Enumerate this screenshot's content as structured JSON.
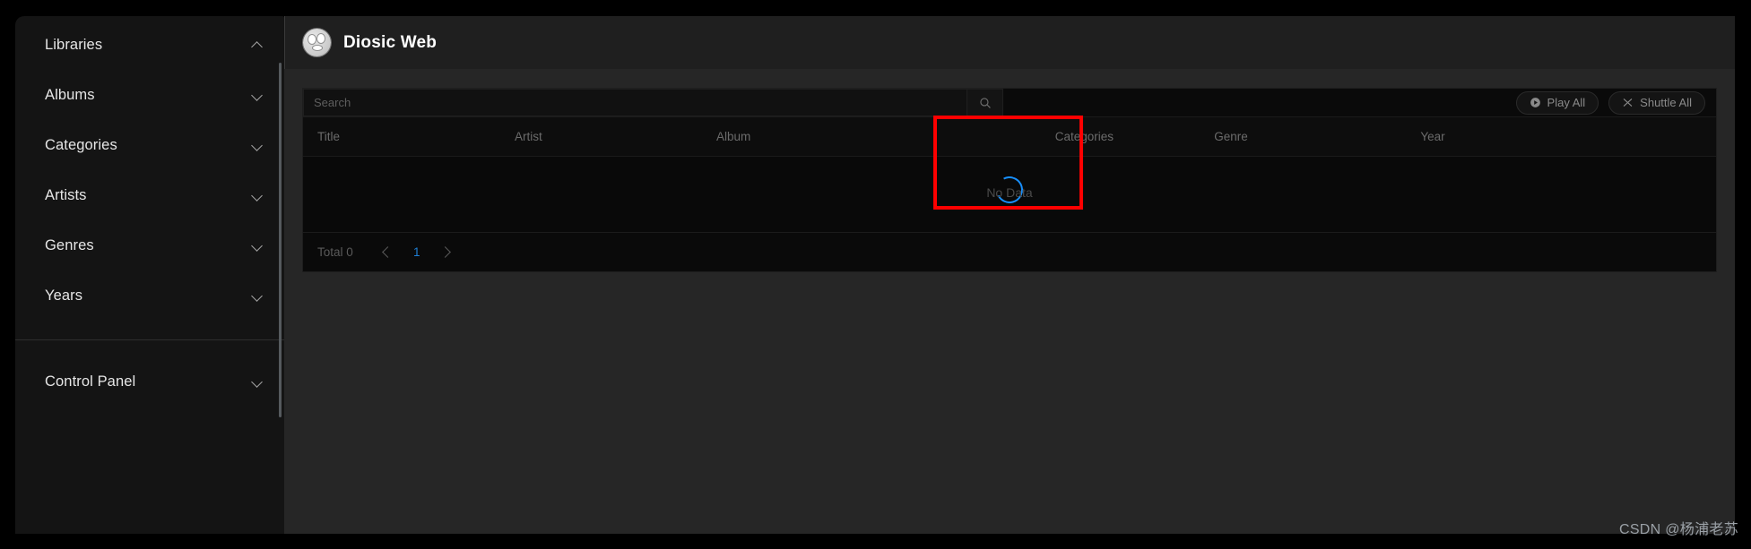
{
  "app": {
    "title": "Diosic Web",
    "logo_icon": "face-logo-icon"
  },
  "sidebar": {
    "items": [
      {
        "label": "Libraries",
        "icon": "chevron-up-icon",
        "expanded": true
      },
      {
        "label": "Albums",
        "icon": "chevron-down-icon",
        "expanded": false
      },
      {
        "label": "Categories",
        "icon": "chevron-down-icon",
        "expanded": false
      },
      {
        "label": "Artists",
        "icon": "chevron-down-icon",
        "expanded": false
      },
      {
        "label": "Genres",
        "icon": "chevron-down-icon",
        "expanded": false
      },
      {
        "label": "Years",
        "icon": "chevron-down-icon",
        "expanded": false
      }
    ],
    "bottom_items": [
      {
        "label": "Control Panel",
        "icon": "chevron-down-icon",
        "expanded": false
      }
    ]
  },
  "toolbar": {
    "search": {
      "value": "",
      "placeholder": "Search",
      "button_icon": "search-icon"
    },
    "play_all": {
      "label": "Play All",
      "icon": "play-circle-icon"
    },
    "shuttle_all": {
      "label": "Shuttle All",
      "icon": "shuffle-icon"
    }
  },
  "table": {
    "columns": [
      "Title",
      "Artist",
      "Album",
      "Categories",
      "Genre",
      "Year"
    ],
    "rows": [],
    "empty_text": "No Data",
    "loading": true,
    "spinner_color": "#1890ff"
  },
  "pagination": {
    "total_label": "Total 0",
    "prev_icon": "chevron-left-icon",
    "current_page": "1",
    "next_icon": "chevron-right-icon"
  },
  "annotation": {
    "highlight_color": "#ff0000"
  },
  "watermark": {
    "text": "CSDN @杨浦老苏"
  }
}
